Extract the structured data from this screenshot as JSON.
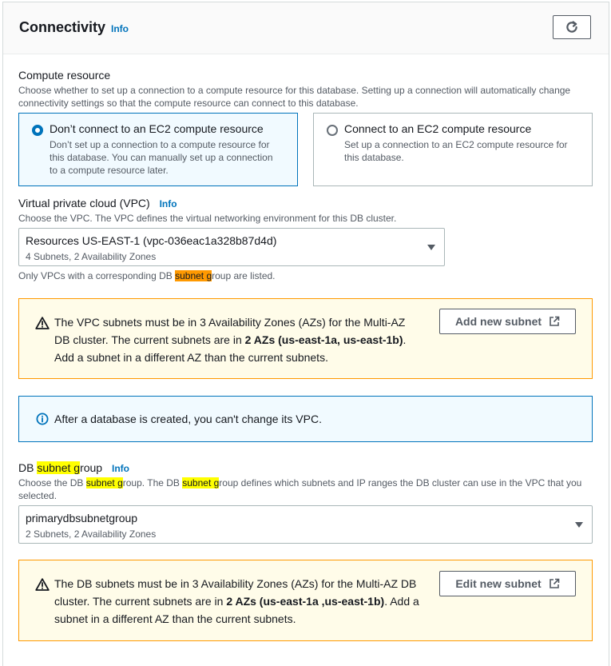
{
  "header": {
    "title": "Connectivity",
    "info": "Info"
  },
  "compute": {
    "label": "Compute resource",
    "description_line1": "Choose whether to set up a connection to a compute resource for this database. Setting up a connection will automatically change",
    "description_line2": "connectivity settings so that the compute resource can connect to this database.",
    "options": [
      {
        "title": "Don’t connect to an EC2 compute resource",
        "desc_lines": [
          "Don’t set up a connection to a compute resource for",
          "this database. You can manually set up a connection",
          "to a compute resource later."
        ],
        "selected": true
      },
      {
        "title": "Connect to an EC2 compute resource",
        "desc_lines": [
          "Set up a connection to an EC2 compute resource for",
          "this database."
        ],
        "selected": false
      }
    ]
  },
  "vpc": {
    "label": "Virtual private cloud (VPC)",
    "info": "Info",
    "description": "Choose the VPC. The VPC defines the virtual networking environment for this DB cluster.",
    "selected": "Resources US-EAST-1 (vpc-036eac1a328b87d4d)",
    "selected_sub": "4 Subnets, 2 Availability Zones",
    "hint_pre": "Only VPCs with a corresponding DB ",
    "hint_hl": "subnet g",
    "hint_post": "roup are listed."
  },
  "vpc_warning": {
    "line1": "The VPC subnets must be in 3 Availability Zones (AZs) for the Multi-AZ",
    "line2_pre": "DB cluster. The current subnets are in ",
    "line2_bold": "2 AZs (us-east-1a, us-east-1b)",
    "line2_post": ".",
    "line3": "Add a subnet in a different AZ than the current subnets.",
    "button": "Add new subnet"
  },
  "vpc_info": {
    "text": "After a database is created, you can't change its VPC."
  },
  "subnet_group": {
    "label_pre": "DB ",
    "label_hl": "subnet g",
    "label_post": "roup",
    "info": "Info",
    "desc1_a": "Choose the DB ",
    "desc1_hl1": "subnet g",
    "desc1_b": "roup. The DB ",
    "desc1_hl2": "subnet g",
    "desc1_c": "roup defines which subnets and IP ranges the DB cluster can use in the VPC that you",
    "desc2": "selected.",
    "selected": "primarydbsubnetgroup",
    "selected_sub": "2 Subnets, 2 Availability Zones"
  },
  "subnet_warning": {
    "line1": "The DB subnets must be in 3 Availability Zones (AZs) for the Multi-AZ DB",
    "line2_pre": "cluster. The current subnets are in ",
    "line2_bold": "2 AZs (us-east-1a ,us-east-1b)",
    "line2_post": ". Add a",
    "line3": "subnet in a different AZ than the current subnets.",
    "button": "Edit new subnet"
  },
  "colors": {
    "accent": "#0073bb",
    "warning": "#ff9900",
    "highlight_current": "#ff9900",
    "highlight_match": "#ffff00"
  }
}
